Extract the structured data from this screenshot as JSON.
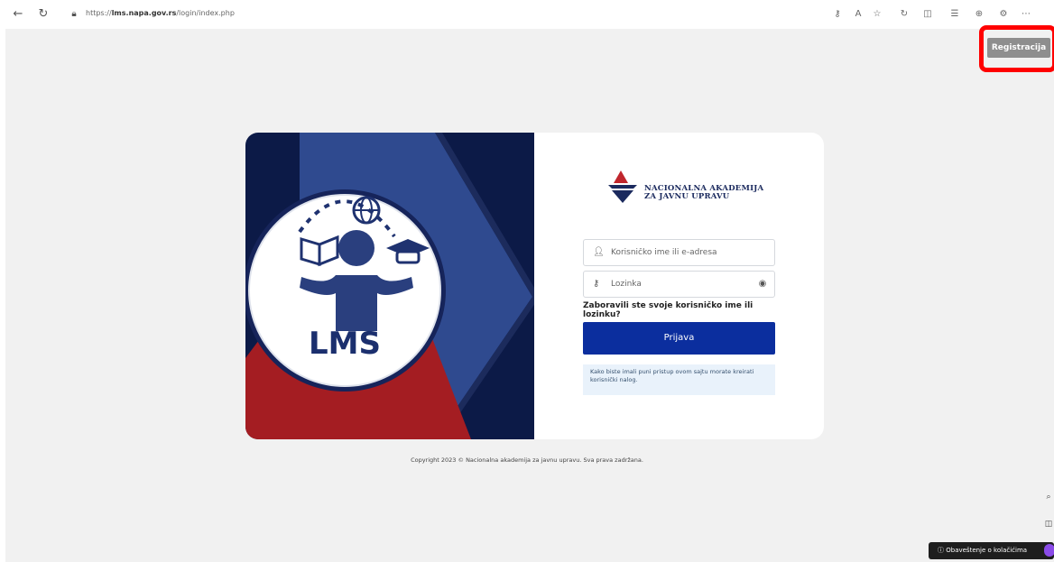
{
  "browser": {
    "url_prefix": "https://",
    "url_host": "lms.napa.gov.rs",
    "url_path": "/login/index.php"
  },
  "header": {
    "register_label": "Registracija"
  },
  "brand": {
    "line1": "NACIONALNA AKADEMIJA",
    "line2": "ZA JAVNU UPRAVU"
  },
  "hero": {
    "logo_text": "LMS"
  },
  "login_form": {
    "username_placeholder": "Korisničko ime ili e-adresa",
    "password_placeholder": "Lozinka",
    "forgot_link": "Zaboravili ste svoje korisničko ime ili lozinku?",
    "submit_label": "Prijava",
    "info_text": "Kako biste imali puni pristup ovom sajtu morate kreirati korisnički nalog."
  },
  "footer": {
    "copyright": "Copyright 2023 © Nacionalna akademija za javnu upravu. Sva prava zadržana."
  },
  "cookie_banner": {
    "label": "Obaveštenje o kolačićima"
  },
  "colors": {
    "primary_button": "#0b2e9e",
    "hero_blue": "#2f4a8f",
    "hero_red": "#a41d22",
    "hero_dark": "#0c1a47",
    "highlight": "#ff0000"
  }
}
